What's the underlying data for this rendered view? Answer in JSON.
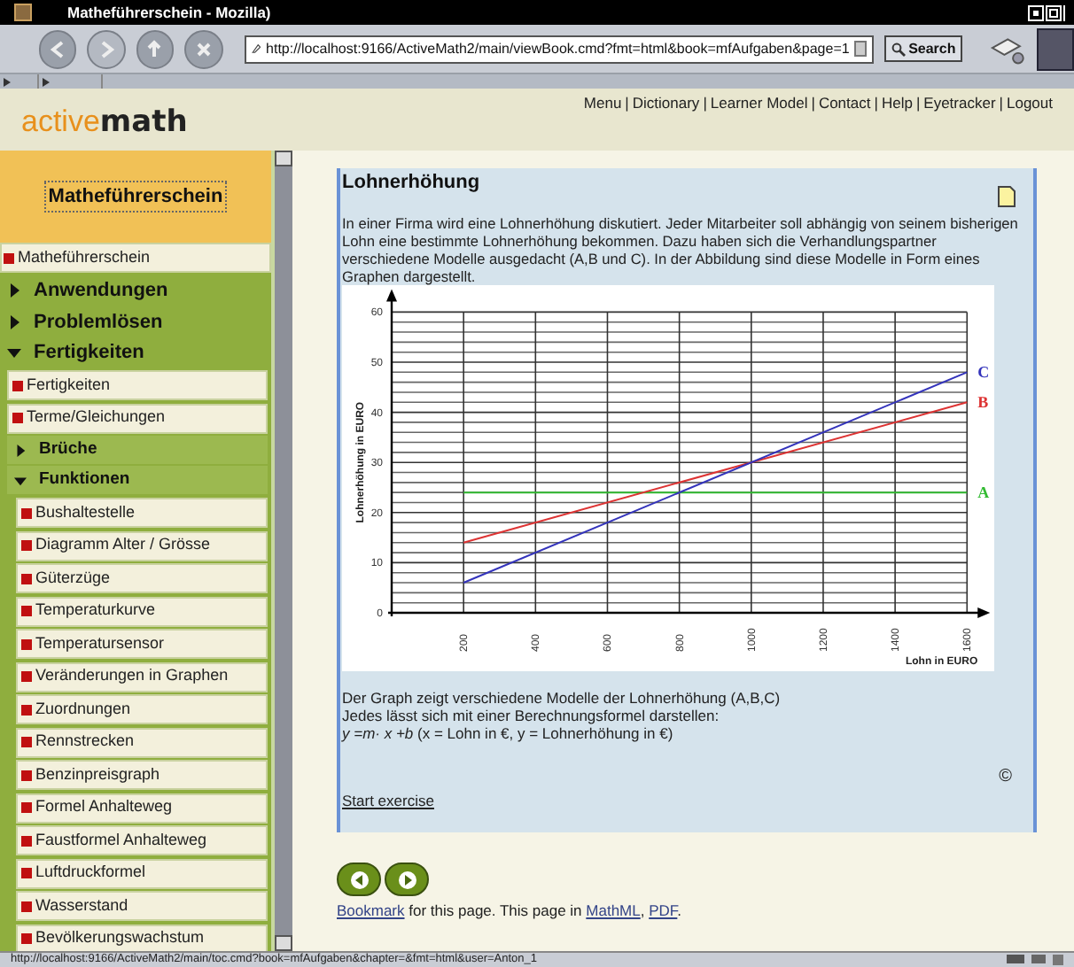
{
  "window": {
    "title": "Matheführerschein - Mozilla)"
  },
  "toolbar": {
    "url": "http://localhost:9166/ActiveMath2/main/viewBook.cmd?fmt=html&book=mfAufgaben&page=1",
    "search_button": "Search"
  },
  "header": {
    "logo": {
      "part_1": "active",
      "part_2": "math"
    },
    "menu_separator": "|",
    "menu": [
      "Menu",
      "Dictionary",
      "Learner Model",
      "Contact",
      "Help",
      "Eyetracker",
      "Logout"
    ]
  },
  "sidebar": {
    "title": "Matheführerschein",
    "items": [
      {
        "kind": "page",
        "label": "Matheführerschein"
      },
      {
        "kind": "section",
        "label": "Anwendungen",
        "expanded": false
      },
      {
        "kind": "section",
        "label": "Problemlösen",
        "expanded": false
      },
      {
        "kind": "section",
        "label": "Fertigkeiten",
        "expanded": true,
        "children": [
          {
            "kind": "page",
            "label": "Fertigkeiten"
          },
          {
            "kind": "page",
            "label": "Terme/Gleichungen"
          },
          {
            "kind": "section",
            "label": "Brüche",
            "expanded": false
          },
          {
            "kind": "section",
            "label": "Funktionen",
            "expanded": true,
            "children": [
              {
                "kind": "page",
                "label": "Bushaltestelle"
              },
              {
                "kind": "page",
                "label": "Diagramm Alter / Grösse"
              },
              {
                "kind": "page",
                "label": "Güterzüge"
              },
              {
                "kind": "page",
                "label": "Temperaturkurve"
              },
              {
                "kind": "page",
                "label": "Temperatursensor"
              },
              {
                "kind": "page",
                "label": "Veränderungen in Graphen"
              },
              {
                "kind": "page",
                "label": "Zuordnungen"
              },
              {
                "kind": "page",
                "label": "Rennstrecken"
              },
              {
                "kind": "page",
                "label": "Benzinpreisgraph"
              },
              {
                "kind": "page",
                "label": "Formel Anhalteweg"
              },
              {
                "kind": "page",
                "label": "Faustformel Anhalteweg"
              },
              {
                "kind": "page",
                "label": "Luftdruckformel"
              },
              {
                "kind": "page",
                "label": "Wasserstand"
              },
              {
                "kind": "page",
                "label": "Bevölkerungswachstum"
              }
            ]
          }
        ]
      }
    ]
  },
  "main": {
    "title": "Lohnerhöhung",
    "intro": "In einer Firma wird eine Lohnerhöhung diskutiert. Jeder Mitarbeiter soll abhängig von seinem bisherigen Lohn eine bestimmte Lohnerhöhung bekommen. Dazu haben sich die Verhandlungspartner verschiedene Modelle ausgedacht (A,B und C). In der Abbildung sind diese Modelle in Form eines Graphen dargestellt.",
    "chart_data": {
      "type": "line",
      "xlabel": "Lohn in EURO",
      "ylabel": "Lohnerhöhung in EURO",
      "x": [
        200,
        1600
      ],
      "series": [
        {
          "name": "A",
          "color": "#33bb33",
          "values": [
            24,
            24
          ]
        },
        {
          "name": "B",
          "color": "#dd3333",
          "values": [
            14,
            42
          ]
        },
        {
          "name": "C",
          "color": "#3333bb",
          "values": [
            6,
            48
          ]
        }
      ],
      "xlim": [
        0,
        1600
      ],
      "ylim": [
        0,
        60
      ],
      "grid": true,
      "xticks": [
        200,
        400,
        600,
        800,
        1000,
        1200,
        1400,
        1600
      ],
      "yticks": [
        0,
        10,
        20,
        30,
        40,
        50,
        60
      ]
    },
    "text_lines": [
      "Der Graph zeigt verschiedene Modelle der Lohnerhöhung (A,B,C)",
      "Jedes lässt sich mit einer Berechnungsformel darstellen:",
      "*y =m· x +b* (x = Lohn in €, y = Lohnerhöhung in €)"
    ],
    "copyright": "©",
    "start_link": "Start exercise"
  },
  "footer": [
    {
      "kind": "link",
      "text": "Bookmark"
    },
    {
      "kind": "text",
      "text": " for this page. This page in "
    },
    {
      "kind": "link",
      "text": "MathML"
    },
    {
      "kind": "text",
      "text": ", "
    },
    {
      "kind": "link",
      "text": "PDF"
    },
    {
      "kind": "text",
      "text": "."
    }
  ],
  "status_bar": {
    "text": "http://localhost:9166/ActiveMath2/main/toc.cmd?book=mfAufgaben&chapter=&fmt=html&user=Anton_1"
  }
}
